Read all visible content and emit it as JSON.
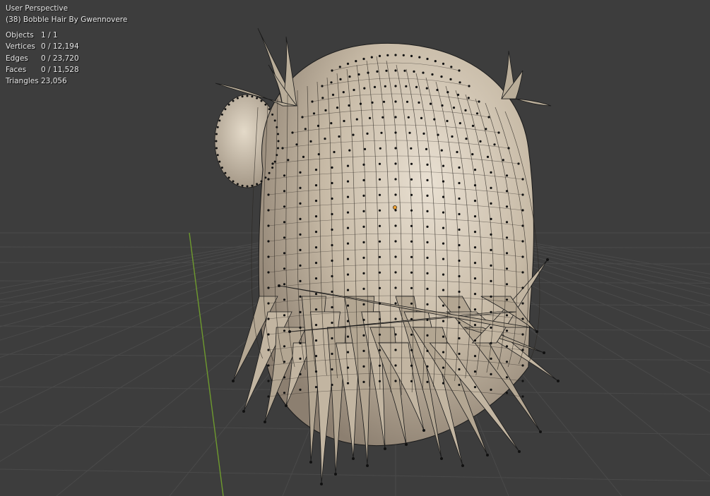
{
  "viewport": {
    "perspective_label": "User Perspective",
    "object_label": "(38) Bobble Hair By Gwennovere"
  },
  "stats": [
    {
      "label": "Objects",
      "value": "1 / 1"
    },
    {
      "label": "Vertices",
      "value": "0 / 12,194"
    },
    {
      "label": "Edges",
      "value": "0 / 23,720"
    },
    {
      "label": "Faces",
      "value": "0 / 11,528"
    },
    {
      "label": "Triangles",
      "value": "23,056"
    }
  ],
  "colors": {
    "background": "#3d3d3d",
    "grid": "#4a4a4a",
    "y_axis": "#6e9a2e",
    "mesh_fill": "#c9bca8",
    "mesh_shadow": "#8f8273",
    "wire": "#1a1a1a"
  },
  "icons": [
    "origin-dot-icon"
  ]
}
